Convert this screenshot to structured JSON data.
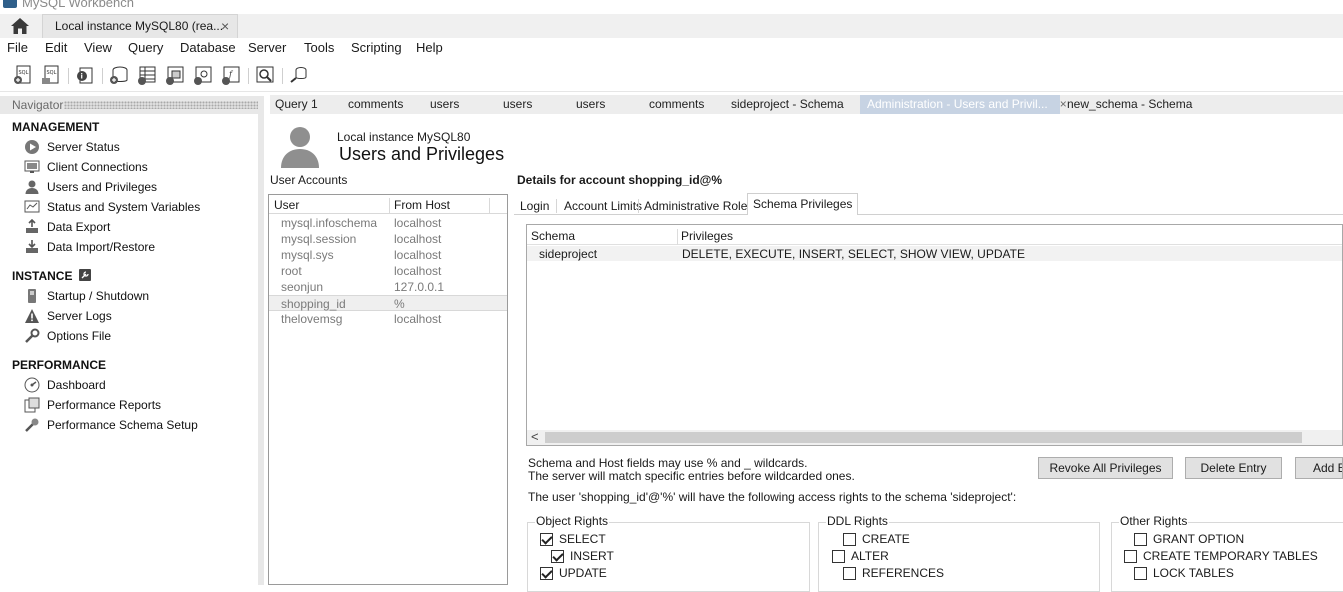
{
  "window": {
    "app_title": "MySQL Workbench"
  },
  "connection_tab": {
    "label": "Local instance MySQL80 (rea...",
    "close": "×"
  },
  "menu": [
    "File",
    "Edit",
    "View",
    "Query",
    "Database",
    "Server",
    "Tools",
    "Scripting",
    "Help"
  ],
  "toolbar": {
    "icons": [
      "new-sql-tab-icon",
      "open-sql-script-icon",
      "inspector-icon",
      "create-schema-icon",
      "create-table-icon",
      "create-view-icon",
      "create-procedure-icon",
      "create-function-icon",
      "search-table-data-icon",
      "reconnect-icon"
    ]
  },
  "navigator": {
    "header": "Navigator",
    "management_label": "MANAGEMENT",
    "management": [
      "Server Status",
      "Client Connections",
      "Users and Privileges",
      "Status and System Variables",
      "Data Export",
      "Data Import/Restore"
    ],
    "instance_label": "INSTANCE",
    "instance": [
      "Startup / Shutdown",
      "Server Logs",
      "Options File"
    ],
    "performance_label": "PERFORMANCE",
    "performance": [
      "Dashboard",
      "Performance Reports",
      "Performance Schema Setup"
    ]
  },
  "tabs": [
    "Query 1",
    "comments",
    "users",
    "users",
    "users",
    "comments",
    "sideproject - Schema",
    "Administration - Users and Privil...",
    "new_schema - Schema"
  ],
  "tab_close": "×",
  "header": {
    "instance": "Local instance MySQL80",
    "title": "Users and Privileges"
  },
  "accounts": {
    "label": "User Accounts",
    "col_user": "User",
    "col_host": "From Host",
    "rows": [
      {
        "user": "mysql.infoschema",
        "host": "localhost"
      },
      {
        "user": "mysql.session",
        "host": "localhost"
      },
      {
        "user": "mysql.sys",
        "host": "localhost"
      },
      {
        "user": "root",
        "host": "localhost"
      },
      {
        "user": "seonjun",
        "host": "127.0.0.1"
      },
      {
        "user": "shopping_id",
        "host": "%"
      },
      {
        "user": "thelovemsg",
        "host": "localhost"
      }
    ]
  },
  "details": {
    "title": "Details for account shopping_id@%",
    "tabs": [
      "Login",
      "Account Limits",
      "Administrative Roles",
      "Schema Privileges"
    ],
    "table": {
      "col_schema": "Schema",
      "col_privileges": "Privileges",
      "rows": [
        {
          "schema": "sideproject",
          "privileges": "DELETE, EXECUTE, INSERT, SELECT, SHOW VIEW, UPDATE"
        }
      ]
    },
    "scroll_left": "<",
    "note_line1": "Schema and Host fields may use % and _ wildcards.",
    "note_line2": "The server will match specific entries before wildcarded ones.",
    "buttons": {
      "revoke": "Revoke All Privileges",
      "delete": "Delete Entry",
      "add": "Add Entry..."
    },
    "access_note": "The user 'shopping_id'@'%' will have the following access rights to the schema 'sideproject':",
    "object_rights": {
      "title": "Object Rights",
      "items": [
        {
          "label": "SELECT",
          "checked": true
        },
        {
          "label": "INSERT",
          "checked": true
        },
        {
          "label": "UPDATE",
          "checked": true
        }
      ]
    },
    "ddl_rights": {
      "title": "DDL Rights",
      "items": [
        {
          "label": "CREATE",
          "checked": false
        },
        {
          "label": "ALTER",
          "checked": false
        },
        {
          "label": "REFERENCES",
          "checked": false
        }
      ]
    },
    "other_rights": {
      "title": "Other Rights",
      "items": [
        {
          "label": "GRANT OPTION",
          "checked": false
        },
        {
          "label": "CREATE TEMPORARY TABLES",
          "checked": false
        },
        {
          "label": "LOCK TABLES",
          "checked": false
        }
      ]
    }
  },
  "colors": {
    "active_tab": "#c7d3e3",
    "panel_gray": "#e8e8e8",
    "accent_blue": "#2f5f8a"
  }
}
